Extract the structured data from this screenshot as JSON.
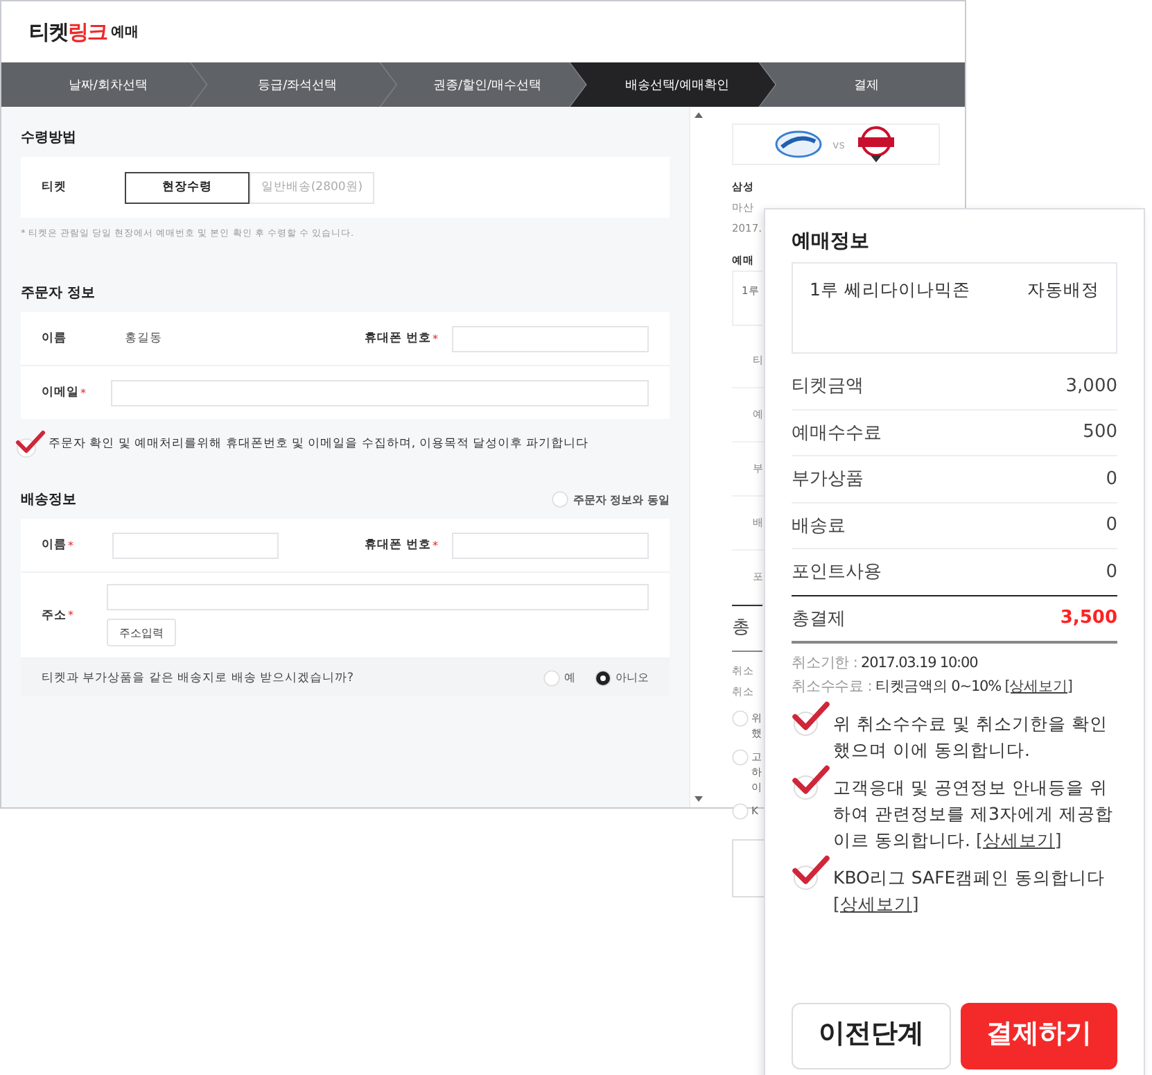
{
  "logo": {
    "main": "티켓",
    "accent": "링크",
    "suffix": "예매"
  },
  "steps": [
    {
      "label": "날짜/회차선택",
      "selected": false
    },
    {
      "label": "등급/좌석선택",
      "selected": false
    },
    {
      "label": "권종/할인/매수선택",
      "selected": false
    },
    {
      "label": "배송선택/예매확인",
      "selected": true
    },
    {
      "label": "결제",
      "selected": false
    }
  ],
  "receive": {
    "title": "수령방법",
    "label": "티켓",
    "options": [
      {
        "label": "현장수령",
        "selected": true
      },
      {
        "label": "일반배송(2800원)",
        "selected": false
      }
    ],
    "note": "* 티켓은 관람일 당일 현장에서 예매번호 및 본인 확인 후 수령할 수 있습니다."
  },
  "orderer": {
    "title": "주문자 정보",
    "name_label": "이름",
    "name_value": "홍길동",
    "phone_label": "휴대폰 번호",
    "phone_mark": "*",
    "email_label": "이메일",
    "email_mark": "*",
    "consent": {
      "text": "주문자 확인 및 예매처리를위해 휴대폰번호 및 이메일을 수집하며, 이용목적 달성이후 파기합니다",
      "checked": true
    }
  },
  "delivery": {
    "title": "배송정보",
    "same_as_orderer": {
      "label": "주문자 정보와 동일",
      "checked": false
    },
    "name_label": "이름",
    "name_mark": "*",
    "phone_label": "휴대폰 번호",
    "phone_mark": "*",
    "address_label": "주소",
    "address_mark": "*",
    "address_button": "주소입력",
    "question": "티켓과 부가상품을 같은 배송지로 배송 받으시겠습니까?",
    "answers": [
      {
        "label": "예",
        "selected": false
      },
      {
        "label": "아니오",
        "selected": true
      }
    ]
  },
  "sidebar": {
    "vs": "vs",
    "fragments": [
      {
        "kind": "bold",
        "text": "삼성"
      },
      {
        "kind": "small",
        "text": "마산"
      },
      {
        "kind": "small",
        "text": "2017."
      },
      {
        "kind": "heading",
        "text": "예매"
      },
      {
        "kind": "boxed",
        "text": "1루"
      },
      {
        "kind": "row",
        "text": "티"
      },
      {
        "kind": "row",
        "text": "예"
      },
      {
        "kind": "row",
        "text": "부"
      },
      {
        "kind": "row",
        "text": "배"
      },
      {
        "kind": "row",
        "text": "포"
      },
      {
        "kind": "total",
        "text": "총"
      },
      {
        "kind": "small",
        "text": "취소"
      },
      {
        "kind": "small",
        "text": "취소"
      }
    ],
    "agreements": [
      {
        "lines": [
          "위",
          "했"
        ],
        "checked": false
      },
      {
        "lines": [
          "고",
          "하",
          "이"
        ],
        "checked": false
      },
      {
        "lines": [
          "K"
        ],
        "checked": false
      }
    ]
  },
  "panel": {
    "title": "예매정보",
    "seat": {
      "zone": "1루 쎄리다이나믹존",
      "assignment": "자동배정"
    },
    "costs": [
      {
        "label": "티켓금액",
        "value": "3,000"
      },
      {
        "label": "예매수수료",
        "value": "500"
      },
      {
        "label": "부가상품",
        "value": "0"
      },
      {
        "label": "배송료",
        "value": "0"
      },
      {
        "label": "포인트사용",
        "value": "0"
      }
    ],
    "total": {
      "label": "총결제",
      "value": "3,500"
    },
    "cancel": [
      {
        "label": "취소기한 :",
        "value": "2017.03.19 10:00"
      },
      {
        "label": "취소수수료 :",
        "value": "티켓금액의 0~10%",
        "link": "[상세보기]"
      }
    ],
    "agreements": [
      {
        "text": "위 취소수수료 및 취소기한을 확인했으며 이에 동의합니다.",
        "checked": true
      },
      {
        "text": "고객응대 및 공연정보 안내등을 위하여 관련정보를 제3자에게 제공합이르 동의합니다.",
        "link": "[상세보기]",
        "checked": true
      },
      {
        "text": "KBO리그 SAFE캠페인 동의합니다",
        "link": "[상세보기]",
        "checked": true
      }
    ],
    "buttons": [
      {
        "label": "이전단계",
        "kind": "secondary"
      },
      {
        "label": "결제하기",
        "kind": "primary"
      }
    ]
  }
}
